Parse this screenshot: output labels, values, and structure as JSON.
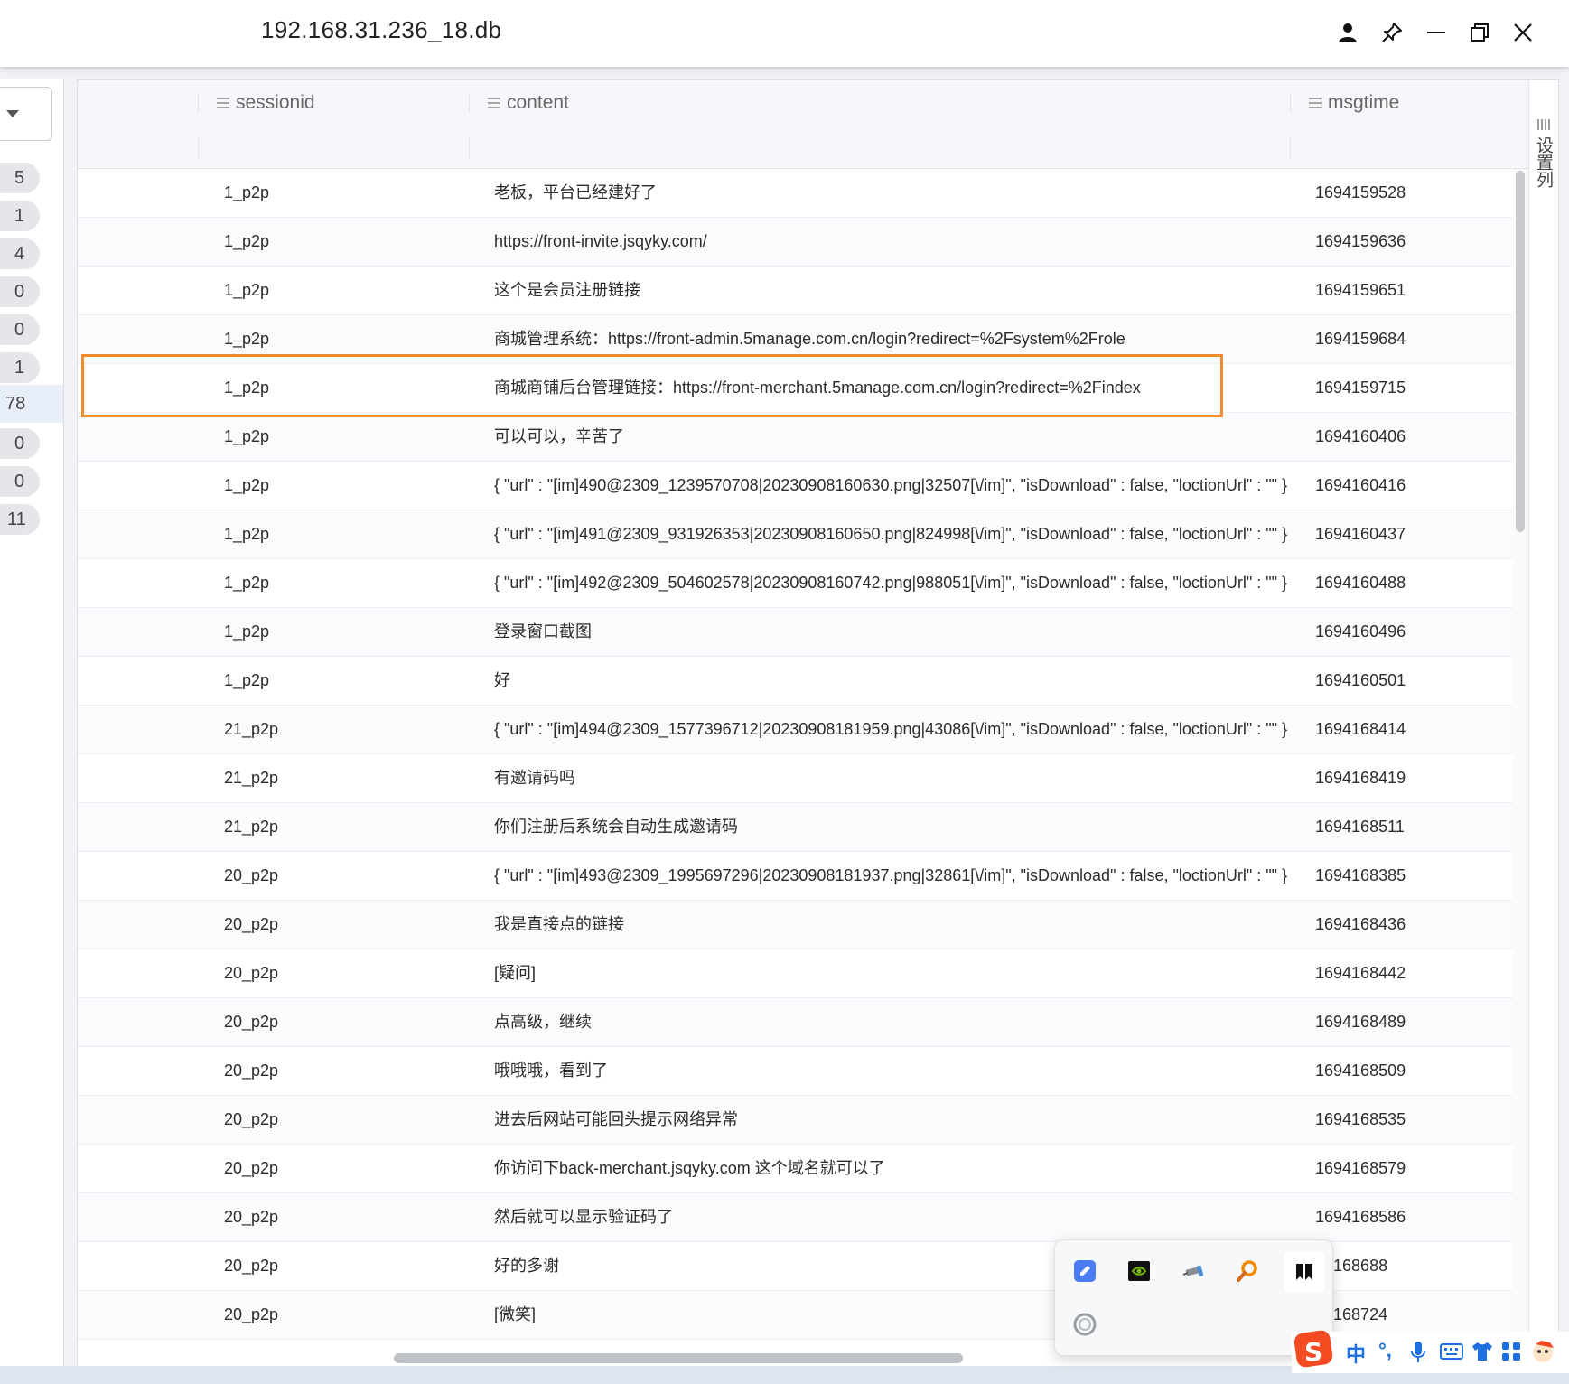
{
  "window": {
    "title": "192.168.31.236_18.db"
  },
  "left_panel": {
    "counts": [
      "5",
      "1",
      "4",
      "0",
      "0",
      "1",
      "78",
      "0",
      "0",
      "11"
    ]
  },
  "table": {
    "columns": [
      "sessionid",
      "content",
      "msgtime"
    ],
    "settings_label": "设置列",
    "rows": [
      {
        "sessionid": "1_p2p",
        "content": "老板，平台已经建好了",
        "msgtime": "1694159528"
      },
      {
        "sessionid": "1_p2p",
        "content": "https://front-invite.jsqyky.com/",
        "msgtime": "1694159636"
      },
      {
        "sessionid": "1_p2p",
        "content": "这个是会员注册链接",
        "msgtime": "1694159651"
      },
      {
        "sessionid": "1_p2p",
        "content": "商城管理系统：https://front-admin.5manage.com.cn/login?redirect=%2Fsystem%2Frole",
        "msgtime": "1694159684"
      },
      {
        "sessionid": "1_p2p",
        "content": "商城商铺后台管理链接：https://front-merchant.5manage.com.cn/login?redirect=%2Findex",
        "msgtime": "1694159715"
      },
      {
        "sessionid": "1_p2p",
        "content": "可以可以，辛苦了",
        "msgtime": "1694160406"
      },
      {
        "sessionid": "1_p2p",
        "content": "{ \"url\" : \"[im]490@2309_1239570708|20230908160630.png|32507[\\/im]\", \"isDownload\" : false, \"loctionUrl\" : \"\" }",
        "msgtime": "1694160416"
      },
      {
        "sessionid": "1_p2p",
        "content": "{ \"url\" : \"[im]491@2309_931926353|20230908160650.png|824998[\\/im]\", \"isDownload\" : false, \"loctionUrl\" : \"\" }",
        "msgtime": "1694160437"
      },
      {
        "sessionid": "1_p2p",
        "content": "{ \"url\" : \"[im]492@2309_504602578|20230908160742.png|988051[\\/im]\", \"isDownload\" : false, \"loctionUrl\" : \"\" }",
        "msgtime": "1694160488"
      },
      {
        "sessionid": "1_p2p",
        "content": "登录窗口截图",
        "msgtime": "1694160496"
      },
      {
        "sessionid": "1_p2p",
        "content": "好",
        "msgtime": "1694160501"
      },
      {
        "sessionid": "21_p2p",
        "content": "{ \"url\" : \"[im]494@2309_1577396712|20230908181959.png|43086[\\/im]\", \"isDownload\" : false, \"loctionUrl\" : \"\" }",
        "msgtime": "1694168414"
      },
      {
        "sessionid": "21_p2p",
        "content": "有邀请码吗",
        "msgtime": "1694168419"
      },
      {
        "sessionid": "21_p2p",
        "content": "你们注册后系统会自动生成邀请码",
        "msgtime": "1694168511"
      },
      {
        "sessionid": "20_p2p",
        "content": "{ \"url\" : \"[im]493@2309_1995697296|20230908181937.png|32861[\\/im]\", \"isDownload\" : false, \"loctionUrl\" : \"\" }",
        "msgtime": "1694168385"
      },
      {
        "sessionid": "20_p2p",
        "content": "我是直接点的链接",
        "msgtime": "1694168436"
      },
      {
        "sessionid": "20_p2p",
        "content": "[疑问]",
        "msgtime": "1694168442"
      },
      {
        "sessionid": "20_p2p",
        "content": "点高级，继续",
        "msgtime": "1694168489"
      },
      {
        "sessionid": "20_p2p",
        "content": "哦哦哦，看到了",
        "msgtime": "1694168509"
      },
      {
        "sessionid": "20_p2p",
        "content": "进去后网站可能回头提示网络异常",
        "msgtime": "1694168535"
      },
      {
        "sessionid": "20_p2p",
        "content": "你访问下back-merchant.jsqyky.com 这个域名就可以了",
        "msgtime": "1694168579"
      },
      {
        "sessionid": "20_p2p",
        "content": "然后就可以显示验证码了",
        "msgtime": "1694168586"
      },
      {
        "sessionid": "20_p2p",
        "content": "好的多谢",
        "msgtime": "94168688"
      },
      {
        "sessionid": "20_p2p",
        "content": "[微笑]",
        "msgtime": "94168724"
      }
    ]
  },
  "ime": {
    "lang_label": "中",
    "punct_label": "°,"
  },
  "colors": {
    "highlight": "#f28a2e",
    "ime_accent": "#1e6fe0"
  }
}
